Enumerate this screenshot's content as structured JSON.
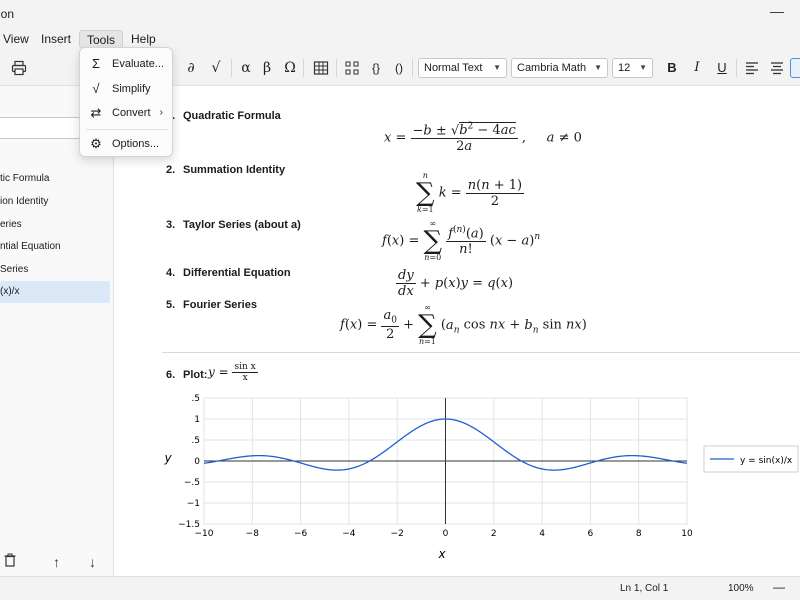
{
  "window": {
    "title_fragment": "ion"
  },
  "menu": {
    "view": "View",
    "insert": "Insert",
    "tools": "Tools",
    "help": "Help"
  },
  "tools_menu": {
    "evaluate": "Evaluate...",
    "simplify": "Simplify",
    "convert": "Convert",
    "options": "Options..."
  },
  "toolbar": {
    "style": "Normal Text",
    "font": "Cambria Math",
    "size": "12",
    "symbols": {
      "partial": "∂",
      "sqrt": "√",
      "alpha": "α",
      "beta": "β",
      "omega": "Ω",
      "braces": "{}",
      "parens": "()"
    },
    "bold": "B",
    "italic": "I",
    "underline": "U"
  },
  "sidebar": {
    "search_placeholder": "s",
    "items": [
      "tic Formula",
      "ion Identity",
      "eries",
      "ntial Equation",
      "Series",
      "(x)/x"
    ],
    "selected_index": 5
  },
  "document": {
    "sections": [
      {
        "num": "1.",
        "title": "Quadratic Formula"
      },
      {
        "num": "2.",
        "title": "Summation Identity"
      },
      {
        "num": "3.",
        "title": "Taylor Series (about a)"
      },
      {
        "num": "4.",
        "title": "Differential Equation"
      },
      {
        "num": "5.",
        "title": "Fourier Series"
      },
      {
        "num": "6.",
        "title": "Plot:"
      }
    ],
    "plot_title_eq": "y =",
    "plot_title_num": "sin x",
    "plot_title_den": "x"
  },
  "chart_data": {
    "type": "line",
    "function": "sin(x)/x",
    "xlim": [
      -10,
      10
    ],
    "ylim": [
      -1.5,
      1.5
    ],
    "xticks": [
      -10,
      -8,
      -6,
      -4,
      -2,
      0,
      2,
      4,
      6,
      8,
      10
    ],
    "yticks": [
      -1.5,
      -1,
      -0.5,
      0,
      0.5,
      1,
      1.5
    ],
    "xtick_labels": [
      "−10",
      "−8",
      "−6",
      "−4",
      "−2",
      "0",
      "2",
      "4",
      "6",
      "8",
      "10"
    ],
    "ytick_labels": [
      "−1.5",
      "−1",
      "−.5",
      "0",
      ".5",
      "1",
      ".5"
    ],
    "xlabel": "x",
    "ylabel": "y",
    "grid": true,
    "legend_position": "right",
    "series": [
      {
        "name": "y = sin(x)/x",
        "color": "#1f5fd6"
      }
    ]
  },
  "status": {
    "position": "Ln 1, Col 1",
    "zoom": "100%"
  }
}
